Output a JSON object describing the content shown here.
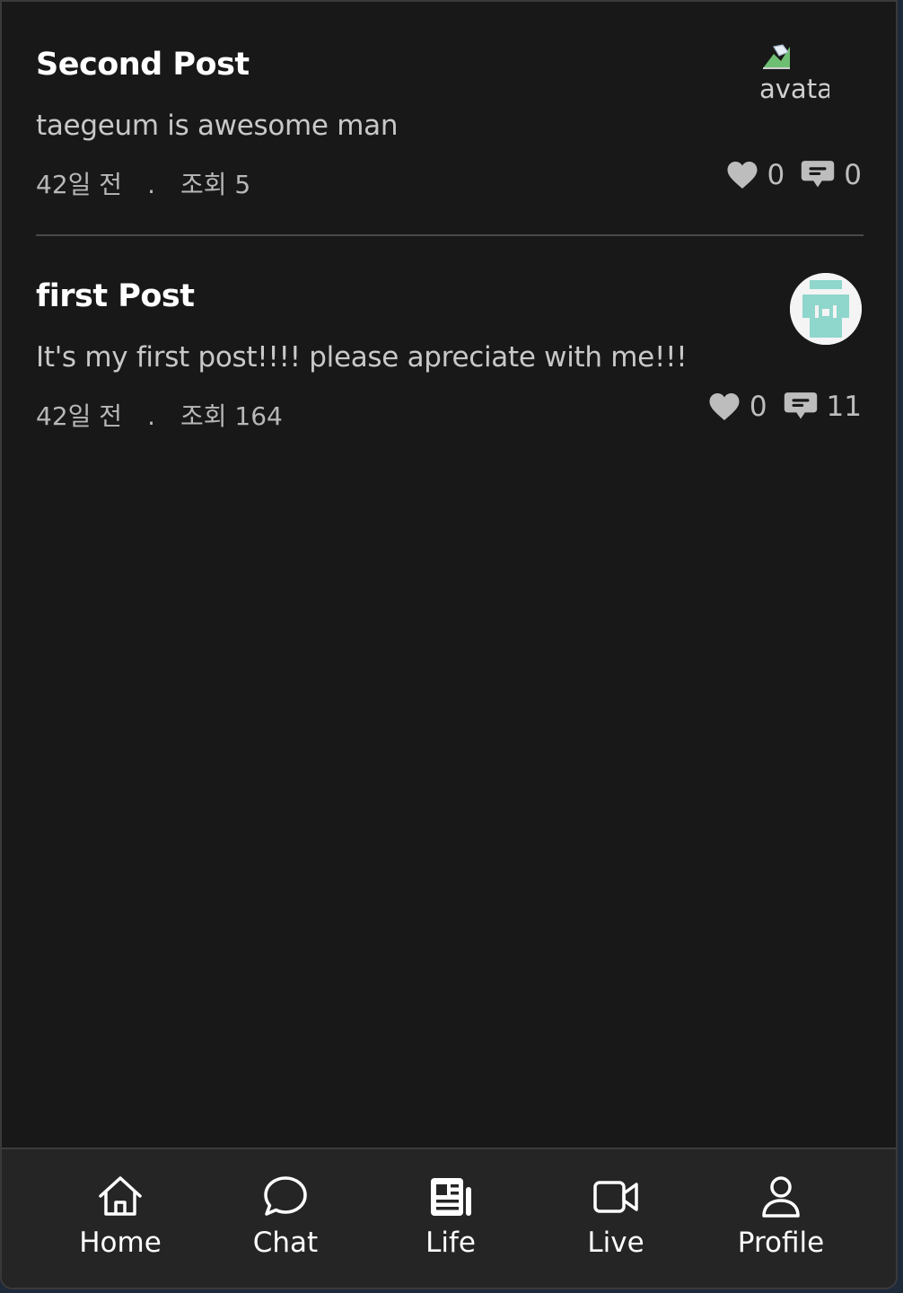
{
  "posts": [
    {
      "title": "Second Post",
      "body": "taegeum is awesome man",
      "time": "42일 전",
      "separator": ".",
      "views": "조회 5",
      "likes": "0",
      "comments": "0",
      "avatar_alt": "avatar",
      "avatar_icon": "broken-image-icon"
    },
    {
      "title": "first Post",
      "body": "It's my first post!!!! please apreciate with me!!!",
      "time": "42일 전",
      "separator": ".",
      "views": "조회 164",
      "likes": "0",
      "comments": "11",
      "avatar_icon": "identicon-avatar"
    }
  ],
  "nav": {
    "items": [
      {
        "label": "Home",
        "icon": "home-icon"
      },
      {
        "label": "Chat",
        "icon": "chat-bubble-icon"
      },
      {
        "label": "Life",
        "icon": "newspaper-icon"
      },
      {
        "label": "Live",
        "icon": "video-camera-icon"
      },
      {
        "label": "Profile",
        "icon": "user-icon"
      }
    ]
  },
  "colors": {
    "background": "#181818",
    "navbar": "#252525",
    "divider": "#4a4a4a",
    "avatar_accent": "#8fd6cc"
  }
}
